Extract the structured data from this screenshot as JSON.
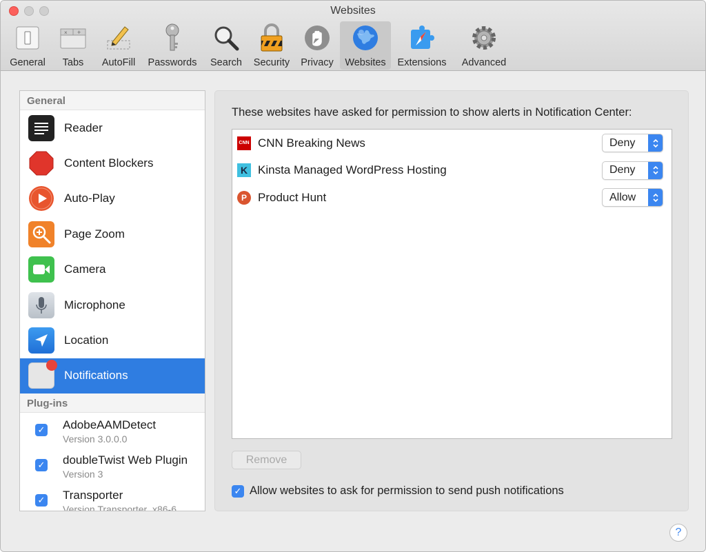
{
  "window": {
    "title": "Websites"
  },
  "toolbar": {
    "items": [
      {
        "label": "General",
        "icon": "general-switch-icon"
      },
      {
        "label": "Tabs",
        "icon": "tabs-icon"
      },
      {
        "label": "AutoFill",
        "icon": "pencil-icon"
      },
      {
        "label": "Passwords",
        "icon": "key-icon"
      },
      {
        "label": "Search",
        "icon": "magnifier-icon"
      },
      {
        "label": "Security",
        "icon": "lock-icon"
      },
      {
        "label": "Privacy",
        "icon": "hand-icon"
      },
      {
        "label": "Websites",
        "icon": "globe-icon",
        "active": true
      },
      {
        "label": "Extensions",
        "icon": "compass-puzzle-icon"
      },
      {
        "label": "Advanced",
        "icon": "gear-icon"
      }
    ]
  },
  "sidebar": {
    "general_header": "General",
    "items": [
      {
        "label": "Reader",
        "icon": "reader-icon"
      },
      {
        "label": "Content Blockers",
        "icon": "stop-sign-icon"
      },
      {
        "label": "Auto-Play",
        "icon": "play-icon"
      },
      {
        "label": "Page Zoom",
        "icon": "zoom-icon"
      },
      {
        "label": "Camera",
        "icon": "camera-icon"
      },
      {
        "label": "Microphone",
        "icon": "microphone-icon"
      },
      {
        "label": "Location",
        "icon": "location-arrow-icon"
      },
      {
        "label": "Notifications",
        "icon": "notifications-icon",
        "selected": true
      }
    ],
    "plugins_header": "Plug-ins",
    "plugins": [
      {
        "name": "AdobeAAMDetect",
        "version": "Version 3.0.0.0",
        "checked": true
      },
      {
        "name": "doubleTwist Web Plugin",
        "version": "Version 3",
        "checked": true
      },
      {
        "name": "Transporter",
        "version": "Version Transporter_x86-6",
        "checked": true
      }
    ]
  },
  "panel": {
    "description": "These websites have asked for permission to show alerts in Notification Center:",
    "sites": [
      {
        "name": "CNN Breaking News",
        "favicon": "cnn-icon",
        "favicon_text": "CNN",
        "permission": "Deny"
      },
      {
        "name": "Kinsta Managed WordPress Hosting",
        "favicon": "kinsta-icon",
        "favicon_text": "K",
        "permission": "Deny"
      },
      {
        "name": "Product Hunt",
        "favicon": "producthunt-icon",
        "favicon_text": "P",
        "permission": "Allow"
      }
    ],
    "remove_label": "Remove",
    "allow_push_label": "Allow websites to ask for permission to send push notifications",
    "allow_push_checked": true
  },
  "help": {
    "label": "?"
  },
  "colors": {
    "accent": "#2f7de1",
    "checkbox": "#3b86f0"
  }
}
